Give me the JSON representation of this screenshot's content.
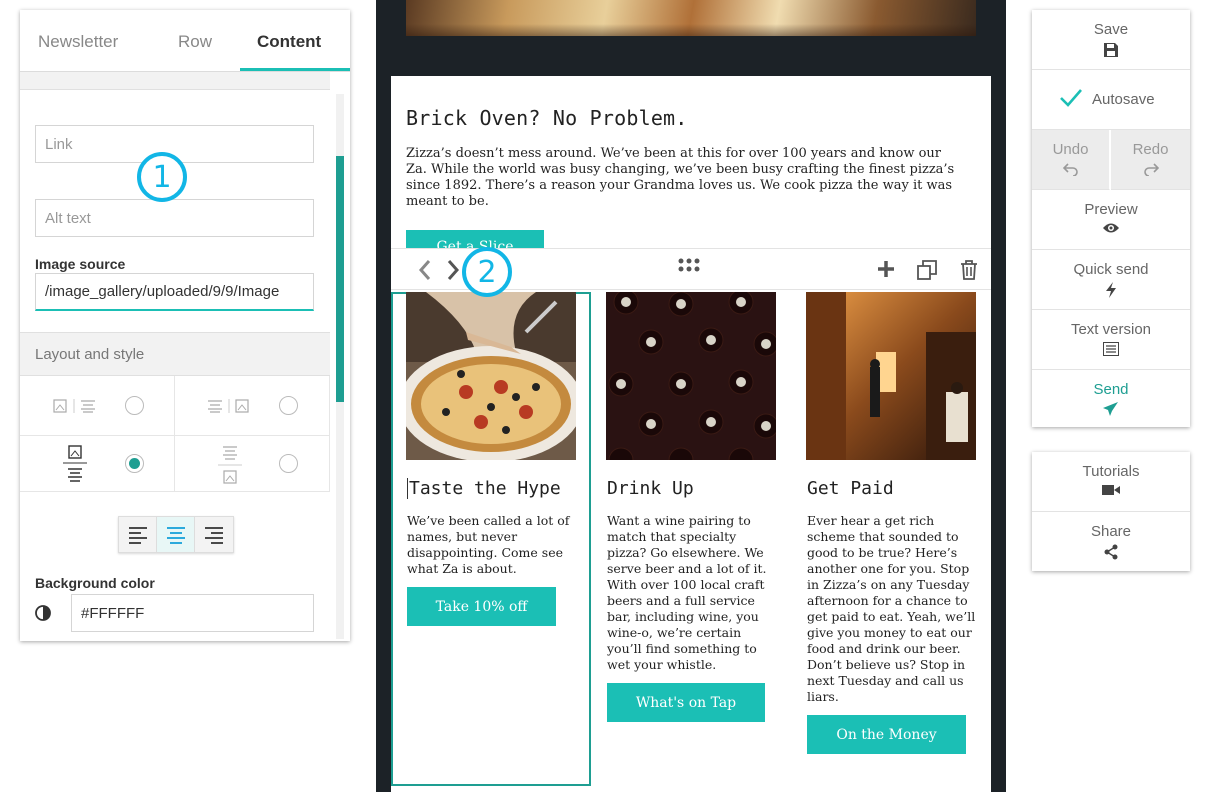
{
  "left_panel": {
    "tabs": [
      "Newsletter",
      "Row",
      "Content"
    ],
    "active_tab": "Content",
    "link_placeholder": "Link",
    "alt_text_placeholder": "Alt text",
    "image_source_label": "Image source",
    "image_source_value": "/image_gallery/uploaded/9/9/Image",
    "layout_section_label": "Layout and style",
    "background_color_label": "Background color",
    "background_color_value": "#FFFFFF"
  },
  "email": {
    "intro_title": "Brick Oven? No Problem.",
    "intro_text": "Zizza’s doesn’t mess around. We’ve been at this for over 100 years and know our Za. While the world was busy changing, we’ve been busy crafting the finest pizza’s since 1892. There’s a reason your Grandma loves us. We cook pizza the way it was meant to be.",
    "intro_button": "Get a Slice",
    "columns": [
      {
        "title": "Taste the Hype",
        "text": "We’ve been called a lot of names, but never disappointing. Come see what Za is about.",
        "button": "Take 10% off"
      },
      {
        "title": "Drink Up",
        "text": "Want a wine pairing to match that specialty pizza? Go elsewhere. We serve beer and a lot of it. With over 100 local craft beers and a full service bar, including wine, you wine-o, we’re certain you’ll find something to wet your whistle.",
        "button": "What's on Tap"
      },
      {
        "title": "Get Paid",
        "text": "Ever hear a get rich scheme that sounded to good to be true? Here’s another one for you. Stop in Zizza’s on any Tuesday afternoon for a chance to get paid to eat. Yeah, we’ll give you money to eat our food and drink our beer. Don’t believe us? Stop in next Tuesday and call us liars.",
        "button": "On the Money"
      }
    ]
  },
  "markers": [
    "1",
    "2"
  ],
  "right_panel": {
    "save": "Save",
    "autosave": "Autosave",
    "undo": "Undo",
    "redo": "Redo",
    "preview": "Preview",
    "quick_send": "Quick send",
    "text_version": "Text version",
    "send": "Send",
    "tutorials": "Tutorials",
    "share": "Share"
  },
  "colors": {
    "accent": "#1bbfb5",
    "selection": "#1e9e92",
    "marker": "#12b6e6",
    "canvas_bg": "#1c2227"
  }
}
